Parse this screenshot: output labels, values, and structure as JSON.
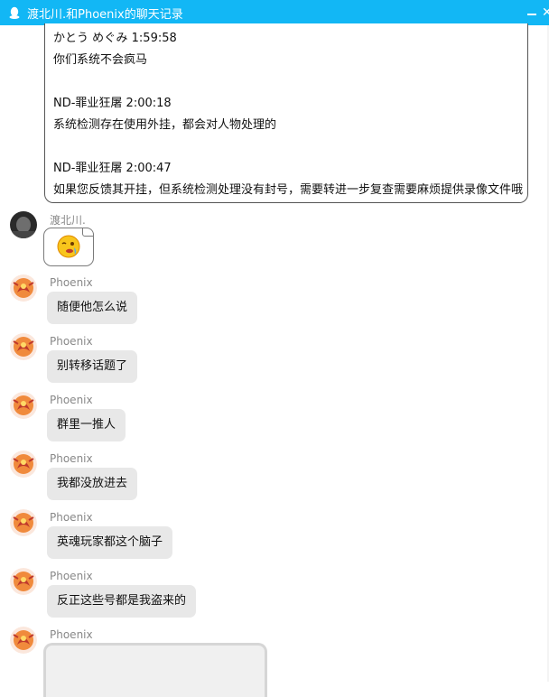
{
  "window": {
    "title": "渡北川.和Phoenix的聊天记录",
    "minimize_glyph": "—",
    "close_glyph": "✕",
    "accent_color": "#12b7f5"
  },
  "quote": {
    "lines": [
      {
        "header": "かとう めぐみ 1:59:58",
        "text": "你们系统不会疯马"
      },
      {
        "header": "ND-罪业狂屠 2:00:18",
        "text": "系统检测存在使用外挂，都会对人物处理的"
      },
      {
        "header": "ND-罪业狂屠 2:00:47",
        "text": "如果您反馈其开挂，但系统检测处理没有封号，需要转进一步复查需要麻烦提供录像文件哦"
      }
    ]
  },
  "messages": [
    {
      "sender": "渡北川.",
      "type": "emoji",
      "emoji": "wink-emoji-icon"
    },
    {
      "sender": "Phoenix",
      "type": "text",
      "text": "随便他怎么说"
    },
    {
      "sender": "Phoenix",
      "type": "text",
      "text": "别转移话题了"
    },
    {
      "sender": "Phoenix",
      "type": "text",
      "text": "群里一推人"
    },
    {
      "sender": "Phoenix",
      "type": "text",
      "text": "我都没放进去"
    },
    {
      "sender": "Phoenix",
      "type": "text",
      "text": "英魂玩家都这个脑子"
    },
    {
      "sender": "Phoenix",
      "type": "text",
      "text": "反正这些号都是我盗来的"
    },
    {
      "sender": "Phoenix",
      "type": "image",
      "text": ""
    }
  ]
}
